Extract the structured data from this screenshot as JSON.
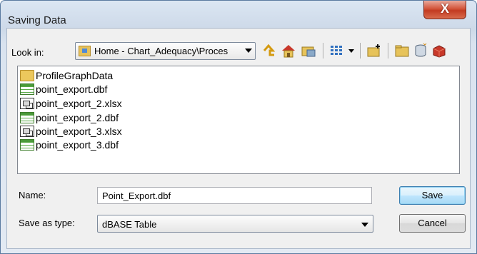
{
  "window": {
    "title": "Saving Data",
    "close_glyph": "X"
  },
  "lookin": {
    "label": "Look in:",
    "value": "Home - Chart_Adequacy\\Proces",
    "icon": "folder-icon"
  },
  "toolbar": {
    "icons": [
      "up-one-level-icon",
      "home-icon",
      "connect-folder-icon",
      "view-list-icon",
      "view-dropdown-icon",
      "new-folder-icon",
      "folder-icon",
      "new-database-icon",
      "toolbox-icon"
    ]
  },
  "files": [
    {
      "name": "ProfileGraphData",
      "icon": "folder-icon"
    },
    {
      "name": "point_export.dbf",
      "icon": "table-icon"
    },
    {
      "name": "point_export_2.xlsx",
      "icon": "excel-icon"
    },
    {
      "name": "point_export_2.dbf",
      "icon": "table-icon"
    },
    {
      "name": "point_export_3.xlsx",
      "icon": "excel-icon"
    },
    {
      "name": "point_export_3.dbf",
      "icon": "table-icon"
    }
  ],
  "name_field": {
    "label": "Name:",
    "value": "Point_Export.dbf"
  },
  "type_field": {
    "label": "Save as type:",
    "value": "dBASE Table"
  },
  "buttons": {
    "save": "Save",
    "cancel": "Cancel"
  },
  "colors": {
    "close_button": "#c33b21",
    "title_bar": "#cdd9e8",
    "default_button_border": "#3c7fb1"
  }
}
